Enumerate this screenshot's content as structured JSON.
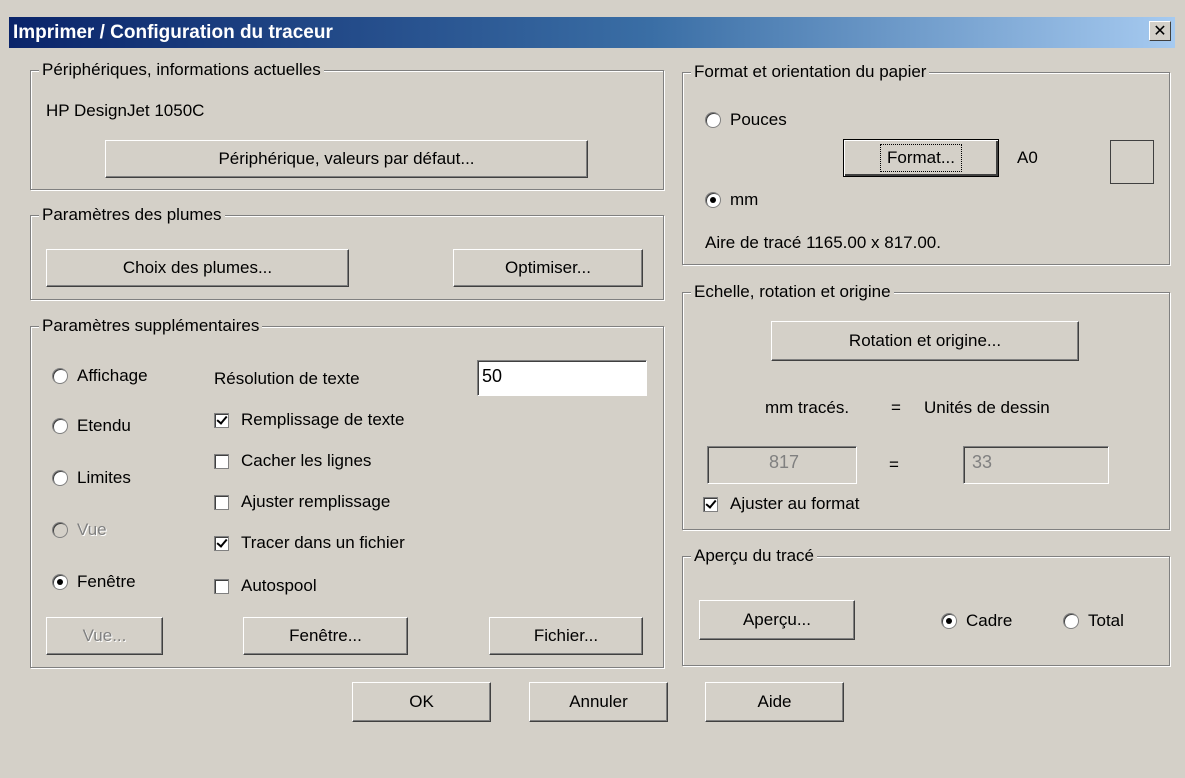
{
  "window": {
    "title": "Imprimer / Configuration du traceur",
    "close_glyph": "✕"
  },
  "device_group": {
    "label": "Périphériques, informations actuelles",
    "device_name": "HP DesignJet 1050C",
    "defaults_button": "Périphérique, valeurs par défaut..."
  },
  "pens_group": {
    "label": "Paramètres des plumes",
    "choose_pens_button": "Choix des plumes...",
    "optimize_button": "Optimiser..."
  },
  "extra_group": {
    "label": "Paramètres supplémentaires",
    "radios": [
      {
        "label": "Affichage",
        "checked": false,
        "disabled": false
      },
      {
        "label": "Etendu",
        "checked": false,
        "disabled": false
      },
      {
        "label": "Limites",
        "checked": false,
        "disabled": false
      },
      {
        "label": "Vue",
        "checked": false,
        "disabled": true
      },
      {
        "label": "Fenêtre",
        "checked": true,
        "disabled": false
      }
    ],
    "text_resolution_label": "Résolution de texte",
    "text_resolution_value": "50",
    "checkboxes": [
      {
        "label": "Remplissage de texte",
        "checked": true
      },
      {
        "label": "Cacher les lignes",
        "checked": false
      },
      {
        "label": "Ajuster remplissage",
        "checked": false
      },
      {
        "label": "Tracer dans un fichier",
        "checked": true
      },
      {
        "label": "Autospool",
        "checked": false
      }
    ],
    "view_button": "Vue...",
    "window_button": "Fenêtre...",
    "file_button": "Fichier..."
  },
  "paper_group": {
    "label": "Format et orientation du papier",
    "inches_label": "Pouces",
    "mm_label": "mm",
    "units_selected": "mm",
    "format_button": "Format...",
    "format_value": "A0",
    "plot_area": "Aire de tracé 1165.00 x 817.00."
  },
  "scale_group": {
    "label": "Echelle, rotation et origine",
    "rotation_button": "Rotation et origine...",
    "mm_plotted_label": "mm tracés.",
    "equals_sign": "=",
    "drawing_units_label": "Unités de dessin",
    "mm_value": "817",
    "units_value": "33",
    "fit_label": "Ajuster au format",
    "fit_checked": true
  },
  "preview_group": {
    "label": "Aperçu du tracé",
    "preview_button": "Aperçu...",
    "frame_label": "Cadre",
    "total_label": "Total",
    "selected": "Cadre"
  },
  "footer": {
    "ok_button": "OK",
    "cancel_button": "Annuler",
    "help_button": "Aide"
  }
}
